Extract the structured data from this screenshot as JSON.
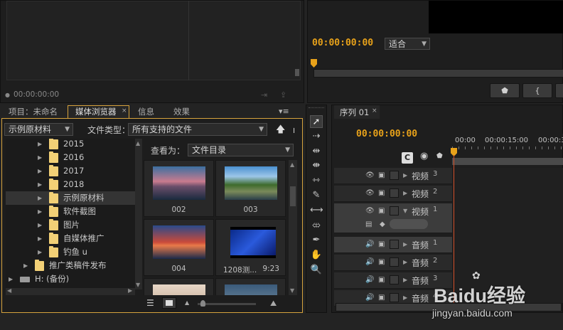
{
  "source_monitor": {
    "timecode": "00:00:00:00"
  },
  "program_monitor": {
    "timecode": "00:00:00:00",
    "fit_label": "适合"
  },
  "project_tabs": [
    "项目：未命名",
    "媒体浏览器",
    "信息",
    "效果"
  ],
  "media_browser": {
    "location": "示例原材料",
    "file_type_label": "文件类型：",
    "file_type_value": "所有支持的文件",
    "view_as_label": "查看为：",
    "view_as_value": "文件目录",
    "tree": [
      {
        "label": "2015",
        "level": 2
      },
      {
        "label": "2016",
        "level": 2
      },
      {
        "label": "2017",
        "level": 2
      },
      {
        "label": "2018",
        "level": 2
      },
      {
        "label": "示例原材料",
        "level": 2,
        "selected": true
      },
      {
        "label": "软件截图",
        "level": 2
      },
      {
        "label": "图片",
        "level": 2
      },
      {
        "label": "自媒体推广",
        "level": 2
      },
      {
        "label": "钓鱼 u",
        "level": 2
      },
      {
        "label": "推广类稿件发布",
        "level": 1
      },
      {
        "label": "H: (备份)",
        "level": 0,
        "drive": true
      }
    ],
    "thumbs": [
      {
        "caption": "002",
        "kind": "lake-dusk"
      },
      {
        "caption": "003",
        "kind": "lake-trees"
      },
      {
        "caption": "004",
        "kind": "sunset"
      },
      {
        "caption": "1208测...",
        "duration": "9:23",
        "kind": "video-blue"
      }
    ]
  },
  "sequence": {
    "tab": "序列 01",
    "timecode": "00:00:00:00",
    "ruler": [
      "00:00",
      "00:00:15:00",
      "00:00:3"
    ],
    "tracks": [
      {
        "name": "视频",
        "num": "3",
        "type": "video"
      },
      {
        "name": "视频",
        "num": "2",
        "type": "video"
      },
      {
        "name": "视频",
        "num": "1",
        "type": "video",
        "expanded": true
      },
      {
        "name": "音频",
        "num": "1",
        "type": "audio",
        "active": true
      },
      {
        "name": "音频",
        "num": "2",
        "type": "audio"
      },
      {
        "name": "音频",
        "num": "3",
        "type": "audio"
      },
      {
        "name": "音频",
        "num": "4",
        "type": "audio"
      }
    ]
  },
  "watermark": {
    "brand": "Baidu经验",
    "url": "jingyan.baidu.com"
  },
  "colors": {
    "accent": "#e8a21a",
    "playhead": "#d4502a",
    "panel_border": "#d6a33d"
  }
}
